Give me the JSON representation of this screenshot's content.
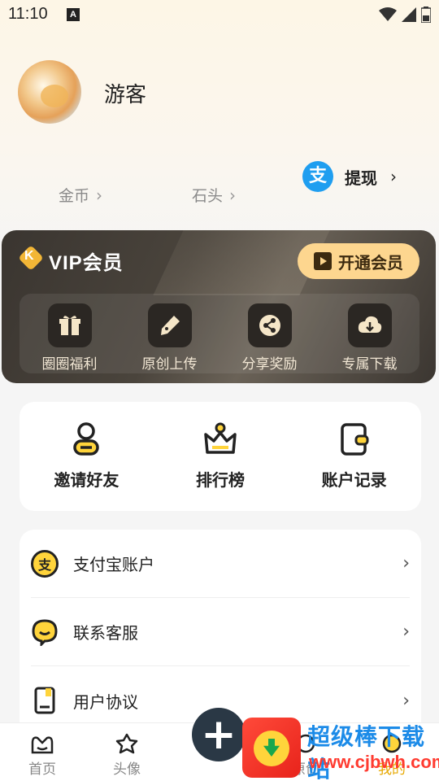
{
  "status_bar": {
    "time": "11:10",
    "a_badge": "A"
  },
  "profile": {
    "username": "游客"
  },
  "stats": [
    {
      "label": "金币"
    },
    {
      "label": "石头"
    }
  ],
  "withdraw": {
    "icon_char": "支",
    "label": "提现"
  },
  "vip": {
    "logo_letter": "K",
    "title": "VIP会员",
    "open_button": "开通会员",
    "benefits": [
      {
        "label": "圈圈福利",
        "icon": "gift-icon"
      },
      {
        "label": "原创上传",
        "icon": "pen-icon"
      },
      {
        "label": "分享奖励",
        "icon": "share-icon"
      },
      {
        "label": "专属下载",
        "icon": "download-icon"
      }
    ]
  },
  "quick_actions": [
    {
      "label": "邀请好友",
      "icon": "invite-icon"
    },
    {
      "label": "排行榜",
      "icon": "ranking-icon"
    },
    {
      "label": "账户记录",
      "icon": "wallet-icon"
    }
  ],
  "menu": [
    {
      "label": "支付宝账户",
      "icon_char": "支",
      "icon": "alipay-icon"
    },
    {
      "label": "联系客服",
      "icon": "customer-service-icon"
    },
    {
      "label": "用户协议",
      "icon": "agreement-icon"
    }
  ],
  "bottom_nav": [
    {
      "label": "首页",
      "icon": "home-icon"
    },
    {
      "label": "头像",
      "icon": "avatar-nav-icon"
    },
    {
      "label": "原创",
      "icon": "original-icon"
    },
    {
      "label": "我的",
      "icon": "mine-icon"
    }
  ],
  "fab_label": "+",
  "watermark": {
    "title": "超级棒下载站",
    "url": "www.cjbwh.com"
  },
  "colors": {
    "accent": "#fdd68f",
    "alipay": "#1f9ef0",
    "vip_card": "#3a3530",
    "fab": "#2a3845"
  }
}
